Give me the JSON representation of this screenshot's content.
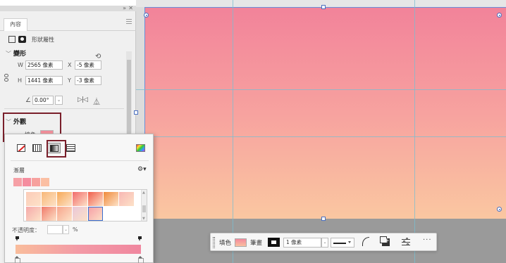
{
  "panel": {
    "tab_label": "內容",
    "mode_label": "形狀屬性",
    "transform": {
      "title": "變形",
      "w_label": "W",
      "w_value": "2565 像素",
      "x_label": "X",
      "x_value": "-5 像素",
      "h_label": "H",
      "h_value": "1441 像素",
      "y_label": "Y",
      "y_value": "-3 像素",
      "rotation_value": "0.00°"
    },
    "appearance": {
      "title": "外觀",
      "fill_label": "填色"
    }
  },
  "popup": {
    "gradient_label": "漸層",
    "opacity_label": "不透明度：",
    "opacity_unit": "%",
    "recent_swatches": [
      "#f6a0a6",
      "#f58d9f",
      "#f7a19e",
      "#fbbfa3"
    ],
    "presets": [
      "#fccbb8",
      "#f8b878",
      "#f7a957",
      "#f26b6b",
      "#f05e4c",
      "#f08a3a",
      "#f8b7b4",
      "#f5a9a9",
      "#f07a6a",
      "#f7a58c",
      "#e9c6d8",
      "#f59da5"
    ]
  },
  "toolbar": {
    "fill_label": "填色",
    "stroke_label": "筆畫",
    "stroke_width": "1 像素"
  },
  "colors": {
    "accent_highlight": "#7a1f2b",
    "gradient_top": "#f2839a",
    "gradient_bottom": "#fac7a1"
  }
}
